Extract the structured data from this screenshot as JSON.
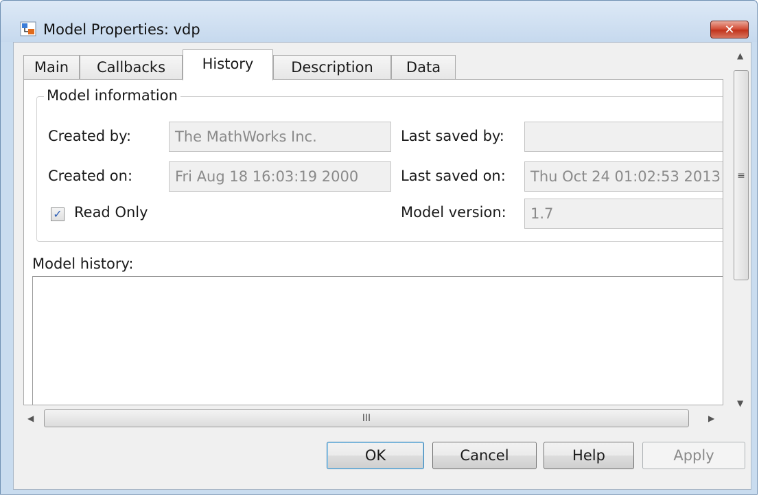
{
  "window": {
    "title": "Model Properties: vdp",
    "close_glyph": "✕"
  },
  "tabs": [
    {
      "label": "Main"
    },
    {
      "label": "Callbacks"
    },
    {
      "label": "History",
      "active": true
    },
    {
      "label": "Description"
    },
    {
      "label": "Data"
    }
  ],
  "model_information": {
    "legend": "Model information",
    "created_by_label": "Created by:",
    "created_by_value": "The MathWorks Inc.",
    "created_on_label": "Created on:",
    "created_on_value": "Fri Aug 18 16:03:19 2000",
    "last_saved_by_label": "Last saved by:",
    "last_saved_by_value": "",
    "last_saved_on_label": "Last saved on:",
    "last_saved_on_value": "Thu Oct 24 01:02:53 2013",
    "model_version_label": "Model version:",
    "model_version_value": "1.7",
    "read_only_label": "Read Only",
    "read_only_checked": true,
    "check_glyph": "✓"
  },
  "model_history": {
    "label": "Model history:",
    "value": ""
  },
  "scrollbars": {
    "up_glyph": "▲",
    "down_glyph": "▼",
    "left_glyph": "◀",
    "right_glyph": "▶",
    "v_grip": "≡",
    "h_grip": "III"
  },
  "buttons": {
    "ok": "OK",
    "cancel": "Cancel",
    "help": "Help",
    "apply": "Apply"
  },
  "colors": {
    "title_bar": "#c6d9ee",
    "close_button": "#c1341d",
    "field_background": "#f0f0f0",
    "checkbox_mark": "#2d5eb5"
  }
}
